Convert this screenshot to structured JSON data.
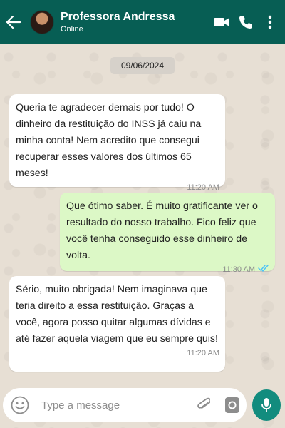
{
  "header": {
    "name": "Professora Andressa",
    "status": "Online",
    "icons": [
      "back-arrow-icon",
      "video-call-icon",
      "phone-icon",
      "more-options-icon"
    ]
  },
  "chat": {
    "date": "09/06/2024",
    "messages": [
      {
        "direction": "in",
        "text": "Queria te agradecer demais por tudo! O dinheiro da restituição do INSS já caiu na minha conta! Nem acredito que consegui recuperar esses valores dos últimos 65 meses!",
        "time": "11:20 AM"
      },
      {
        "direction": "out",
        "text": "Que ótimo saber. É muito gratificante ver o resultado do nosso trabalho. Fico feliz que você tenha conseguido esse dinheiro de volta.",
        "time": "11:30 AM",
        "read": true
      },
      {
        "direction": "in",
        "text": "Sério, muito obrigada! Nem imaginava que teria direito a essa restituição. Graças a você, agora posso quitar algumas dívidas e até fazer aquela viagem que eu sempre quis!",
        "time": "11:20 AM"
      }
    ]
  },
  "input": {
    "placeholder": "Type a message",
    "icons": [
      "emoji-icon",
      "attachment-icon",
      "camera-icon",
      "mic-icon"
    ]
  },
  "colors": {
    "header": "#075e54",
    "outgoing_bubble": "#dcf8c6",
    "incoming_bubble": "#ffffff",
    "mic_button": "#128c7e",
    "read_ticks": "#4fc3f7"
  }
}
